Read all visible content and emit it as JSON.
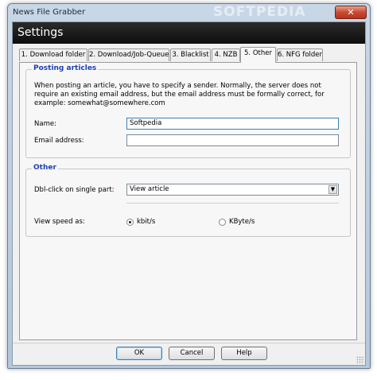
{
  "window": {
    "title": "News File Grabber",
    "watermark": "SOFTPEDIA",
    "close_glyph": "✕",
    "close_icon": "close-icon"
  },
  "header": {
    "title": "Settings"
  },
  "tabs": [
    {
      "label": "1. Download folder",
      "active": false
    },
    {
      "label": "2. Download/Job-Queue",
      "active": false
    },
    {
      "label": "3. Blacklist",
      "active": false
    },
    {
      "label": "4. NZB",
      "active": false
    },
    {
      "label": "5. Other",
      "active": true
    },
    {
      "label": "6. NFG folder",
      "active": false
    }
  ],
  "posting": {
    "group_label": "Posting articles",
    "description": "When posting an article, you have to specify a sender. Normally, the server does not require an existing email address, but the email address must be formally correct, for example: somewhat@somewhere.com",
    "name_label": "Name:",
    "name_value": "Softpedia",
    "email_label": "Email address:",
    "email_value": ""
  },
  "other": {
    "group_label": "Other",
    "dblclick_label": "Dbl-click on single part:",
    "dblclick_value": "View article",
    "dropdown_icon": "chevron-down-icon",
    "speed_label": "View speed as:",
    "speed_options": [
      {
        "label": "kbit/s",
        "checked": true
      },
      {
        "label": "KByte/s",
        "checked": false
      }
    ]
  },
  "buttons": {
    "ok": "OK",
    "cancel": "Cancel",
    "help": "Help"
  }
}
